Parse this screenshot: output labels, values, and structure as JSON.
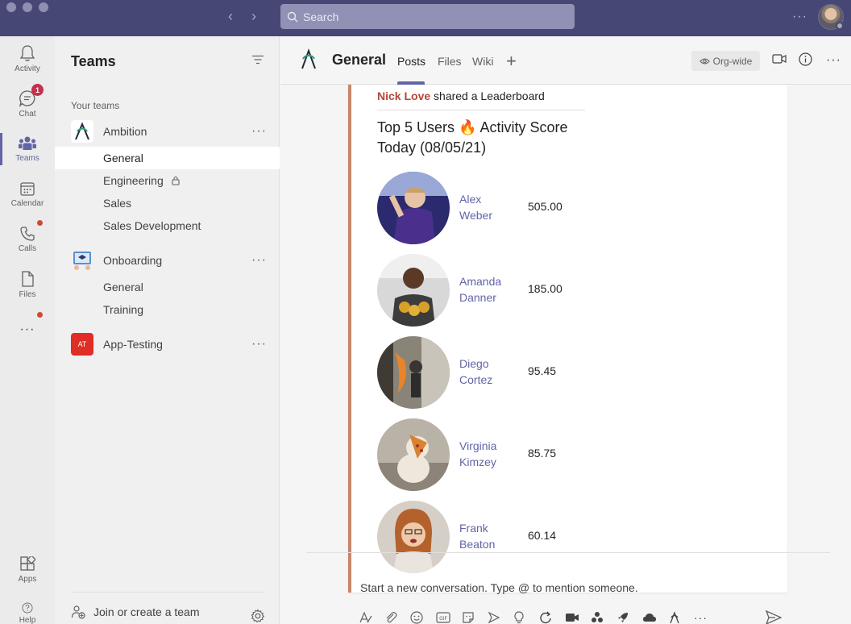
{
  "titlebar": {
    "search_placeholder": "Search",
    "back_arrow": "‹",
    "forward_arrow": "›",
    "more": "···"
  },
  "rail": {
    "items": [
      {
        "label": "Activity",
        "icon": "bell-icon"
      },
      {
        "label": "Chat",
        "icon": "chat-icon",
        "badge": "1"
      },
      {
        "label": "Teams",
        "icon": "teams-icon",
        "active": true
      },
      {
        "label": "Calendar",
        "icon": "calendar-icon"
      },
      {
        "label": "Calls",
        "icon": "phone-icon"
      },
      {
        "label": "Files",
        "icon": "file-icon"
      },
      {
        "label": "···",
        "icon": "more-apps-icon"
      }
    ],
    "apps_label": "Apps",
    "help_label": "Help"
  },
  "teams_panel": {
    "title": "Teams",
    "section_label": "Your teams",
    "teams": [
      {
        "name": "Ambition",
        "channels": [
          "General",
          "Engineering",
          "Sales",
          "Sales Development"
        ]
      },
      {
        "name": "Onboarding",
        "channels": [
          "General",
          "Training"
        ]
      },
      {
        "name": "App-Testing",
        "initials": "AT",
        "channels": []
      }
    ],
    "selected_channel": "General",
    "join_label": "Join or create a team",
    "more": "···"
  },
  "channel": {
    "title": "General",
    "tabs": [
      "Posts",
      "Files",
      "Wiki"
    ],
    "active_tab": "Posts",
    "add_tab": "+",
    "org_wide_label": "Org-wide",
    "more": "···"
  },
  "post": {
    "author": "Nick Love",
    "action": " shared a Leaderboard",
    "leaderboard_title": "Top 5 Users 🔥 Activity Score Today (08/05/21)",
    "entries": [
      {
        "first": "Alex",
        "last": "Weber",
        "score": "505.00"
      },
      {
        "first": "Amanda",
        "last": "Danner",
        "score": "185.00"
      },
      {
        "first": "Diego",
        "last": "Cortez",
        "score": "95.45"
      },
      {
        "first": "Virginia",
        "last": "Kimzey",
        "score": "85.75"
      },
      {
        "first": "Frank",
        "last": "Beaton",
        "score": "60.14"
      }
    ]
  },
  "compose": {
    "placeholder": "Start a new conversation. Type @ to mention someone."
  },
  "colors": {
    "titlebar": "#464775",
    "accent": "#6264a7",
    "post_border": "#c8876b",
    "author": "#b5463a",
    "badge": "#c4314b",
    "app_testing": "#e02d25"
  }
}
